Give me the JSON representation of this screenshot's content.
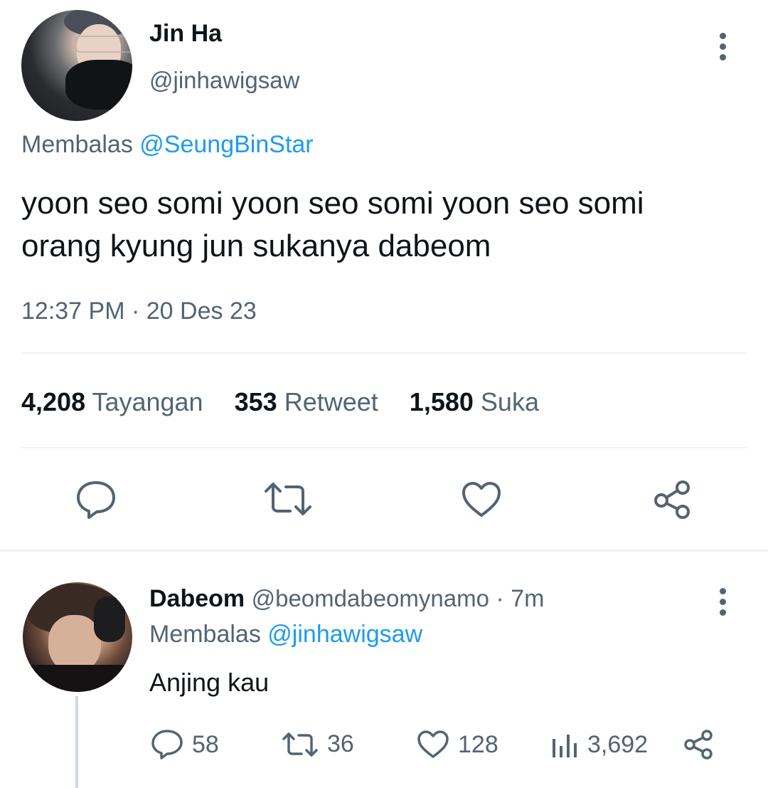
{
  "main_tweet": {
    "author_name": "Jin Ha",
    "author_handle": "@jinhawigsaw",
    "replying_prefix": "Membalas",
    "replying_to": "@SeungBinStar",
    "text_line1": "yoon seo somi yoon seo somi yoon seo somi",
    "text_line2": "orang kyung jun sukanya dabeom",
    "time": "12:37 PM",
    "separator": "·",
    "date": "20 Des 23",
    "stats": {
      "views_count": "4,208",
      "views_label": "Tayangan",
      "retweets_count": "353",
      "retweets_label": "Retweet",
      "likes_count": "1,580",
      "likes_label": "Suka"
    },
    "actions": [
      "reply",
      "retweet",
      "like",
      "share"
    ]
  },
  "reply_tweet": {
    "author_name": "Dabeom",
    "author_handle": "@beomdabeomynamo",
    "separator": "·",
    "time_ago": "7m",
    "replying_prefix": "Membalas",
    "replying_to": "@jinhawigsaw",
    "text": "Anjing kau",
    "actions": {
      "replies": "58",
      "retweets": "36",
      "likes": "128",
      "views": "3,692"
    }
  },
  "colors": {
    "text": "#0f1419",
    "muted": "#536471",
    "link": "#1d9bf0",
    "divider": "#eff3f4"
  }
}
